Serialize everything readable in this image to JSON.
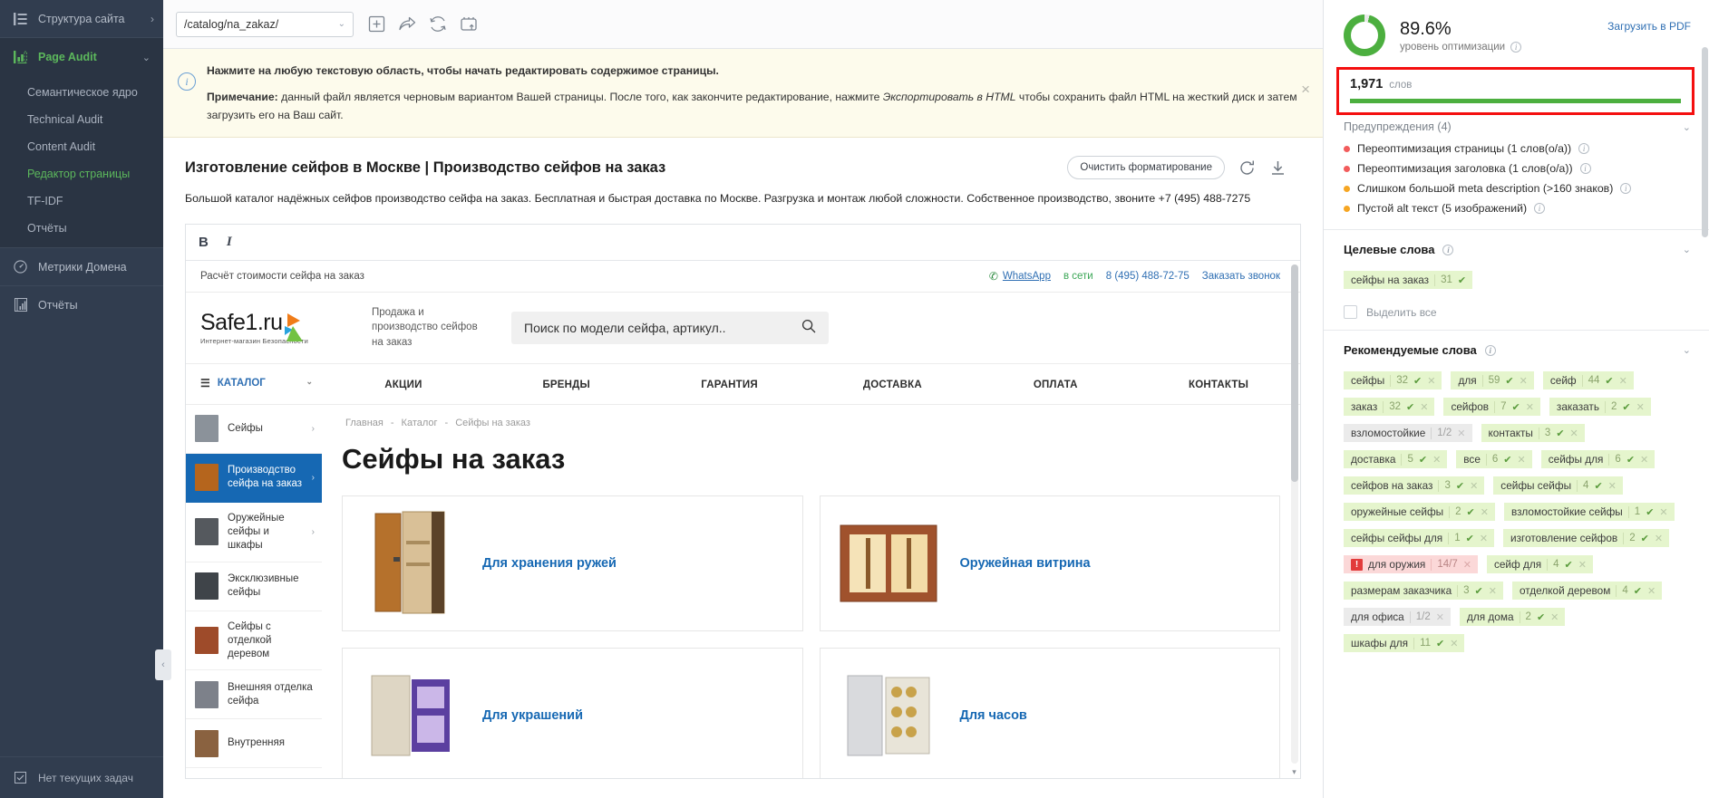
{
  "sidebar": {
    "structure": {
      "label": "Структура сайта",
      "icon": "list-icon",
      "chevron": "›"
    },
    "page_audit": {
      "label": "Page Audit",
      "icon": "bar-chart-icon",
      "chevron": "⌄"
    },
    "sub_items": [
      {
        "label": "Семантическое ядро",
        "selected": false
      },
      {
        "label": "Technical Audit",
        "selected": false
      },
      {
        "label": "Content Audit",
        "selected": false
      },
      {
        "label": "Редактор страницы",
        "selected": true
      },
      {
        "label": "TF-IDF",
        "selected": false
      },
      {
        "label": "Отчёты",
        "selected": false
      }
    ],
    "domain_metrics": {
      "label": "Метрики Домена",
      "icon": "gauge-icon"
    },
    "reports": {
      "label": "Отчёты",
      "icon": "report-icon"
    },
    "footer_status": "Нет текущих задач",
    "collapse_chevron": "‹"
  },
  "toolbar": {
    "url_value": "/catalog/na_zakaz/",
    "url_chevron": "⌄",
    "icons": [
      "add-page-icon",
      "share-icon",
      "refresh-icon",
      "export-html-icon"
    ],
    "menu_icon": "hamburger-icon"
  },
  "banner": {
    "icon": "info-icon",
    "line1": "Нажмите на любую текстовую область, чтобы начать редактировать содержимое страницы.",
    "note_label": "Примечание:",
    "note_part1": " данный файл является черновым вариантом Вашей страницы. После того, как закончите редактирование, нажмите ",
    "note_emphasis": "Экспортировать в HTML",
    "note_part2": " чтобы сохранить файл HTML на жесткий диск и затем загрузить его на Ваш сайт.",
    "close_icon": "close-icon"
  },
  "editor": {
    "page_title": "Изготовление сейфов в Москве | Производство сейфов на заказ",
    "clear_format_label": "Очистить форматирование",
    "refresh_icon": "refresh-icon",
    "download_icon": "download-icon",
    "page_description": "Большой каталог надёжных сейфов производство сейфа на заказ. Бесплатная и быстрая доставка по Москве. Разгрузка и монтаж любой сложности. Собственное производство, звоните +7 (495) 488-7275",
    "format_bold": "B",
    "format_italic": "I"
  },
  "preview": {
    "top_left": "Расчёт стоимости сейфа на заказ",
    "whatsapp_icon": "phone-icon",
    "whatsapp": "WhatsApp",
    "online": "в сети",
    "phone": "8 (495) 488-72-75",
    "callback": "Заказать звонок",
    "logo_main": "Safe1.ru",
    "logo_sub": "Интернет-магазин Безопасности",
    "slogan": "Продажа и производство сейфов на заказ",
    "search_placeholder": "Поиск по модели сейфа, артикул..",
    "search_icon": "search-icon",
    "catalog_label": "КАТАЛОГ",
    "catalog_burger": "☰",
    "nav": [
      "АКЦИИ",
      "БРЕНДЫ",
      "ГАРАНТИЯ",
      "ДОСТАВКА",
      "ОПЛАТА",
      "КОНТАКТЫ"
    ],
    "categories": [
      {
        "label": "Сейфы",
        "selected": false,
        "arrow": "›"
      },
      {
        "label": "Производство сейфа на заказ",
        "selected": true,
        "arrow": "›"
      },
      {
        "label": "Оружейные сейфы и шкафы",
        "selected": false,
        "arrow": "›"
      },
      {
        "label": "Эксклюзивные сейфы",
        "selected": false,
        "arrow": ""
      },
      {
        "label": "Сейфы с отделкой деревом",
        "selected": false,
        "arrow": ""
      },
      {
        "label": "Внешняя отделка сейфа",
        "selected": false,
        "arrow": ""
      },
      {
        "label": "Внутренняя",
        "selected": false,
        "arrow": ""
      }
    ],
    "breadcrumbs": [
      "Главная",
      "Каталог",
      "Сейфы на заказ"
    ],
    "h1": "Сейфы на заказ",
    "cards": [
      {
        "title": "Для хранения ружей"
      },
      {
        "title": "Оружейная витрина"
      },
      {
        "title": "Для украшений"
      },
      {
        "title": "Для часов"
      }
    ]
  },
  "panel": {
    "score_value": "89.6%",
    "score_label": "уровень оптимизации",
    "download_pdf": "Загрузить в PDF",
    "words_count": "1,971",
    "words_label": "слов",
    "warnings_title": "Предупреждения (4)",
    "warnings_chevron": "⌄",
    "warnings": [
      {
        "text": "Переоптимизация страницы (1 слов(о/а))",
        "color": "red"
      },
      {
        "text": "Переоптимизация заголовка (1 слов(о/а))",
        "color": "red"
      },
      {
        "text": "Слишком большой meta description (>160 знаков)",
        "color": "orange"
      },
      {
        "text": "Пустой alt текст (5 изображений)",
        "color": "orange"
      }
    ],
    "target_words": {
      "title": "Целевые слова",
      "chevron": "⌄",
      "chips": [
        {
          "word": "сейфы на заказ",
          "count": "31",
          "state": "green",
          "ok": true,
          "close": false
        }
      ],
      "select_all_label": "Выделить все"
    },
    "recommended_words": {
      "title": "Рекомендуемые слова",
      "chevron": "⌄",
      "chips": [
        {
          "word": "сейфы",
          "count": "32",
          "state": "green",
          "ok": true,
          "close": true
        },
        {
          "word": "для",
          "count": "59",
          "state": "green",
          "ok": true,
          "close": true
        },
        {
          "word": "сейф",
          "count": "44",
          "state": "green",
          "ok": true,
          "close": true
        },
        {
          "word": "заказ",
          "count": "32",
          "state": "green",
          "ok": true,
          "close": true
        },
        {
          "word": "сейфов",
          "count": "7",
          "state": "green",
          "ok": true,
          "close": true
        },
        {
          "word": "заказать",
          "count": "2",
          "state": "green",
          "ok": true,
          "close": true
        },
        {
          "word": "взломостойкие",
          "count": "1/2",
          "state": "grey",
          "ok": false,
          "close": true
        },
        {
          "word": "контакты",
          "count": "3",
          "state": "green",
          "ok": true,
          "close": true
        },
        {
          "word": "доставка",
          "count": "5",
          "state": "green",
          "ok": true,
          "close": true
        },
        {
          "word": "все",
          "count": "6",
          "state": "green",
          "ok": true,
          "close": true
        },
        {
          "word": "сейфы для",
          "count": "6",
          "state": "green",
          "ok": true,
          "close": true
        },
        {
          "word": "сейфов на заказ",
          "count": "3",
          "state": "green",
          "ok": true,
          "close": true
        },
        {
          "word": "сейфы сейфы",
          "count": "4",
          "state": "green",
          "ok": true,
          "close": true
        },
        {
          "word": "оружейные сейфы",
          "count": "2",
          "state": "green",
          "ok": true,
          "close": true
        },
        {
          "word": "взломостойкие сейфы",
          "count": "1",
          "state": "green",
          "ok": true,
          "close": true
        },
        {
          "word": "сейфы сейфы для",
          "count": "1",
          "state": "green",
          "ok": true,
          "close": true
        },
        {
          "word": "изготовление сейфов",
          "count": "2",
          "state": "green",
          "ok": true,
          "close": true
        },
        {
          "word": "для оружия",
          "count": "14/7",
          "state": "pink",
          "ok": false,
          "close": true,
          "alert": true
        },
        {
          "word": "сейф для",
          "count": "4",
          "state": "green",
          "ok": true,
          "close": true
        },
        {
          "word": "размерам заказчика",
          "count": "3",
          "state": "green",
          "ok": true,
          "close": true
        },
        {
          "word": "отделкой деревом",
          "count": "4",
          "state": "green",
          "ok": true,
          "close": true
        },
        {
          "word": "для офиса",
          "count": "1/2",
          "state": "grey",
          "ok": false,
          "close": true
        },
        {
          "word": "для дома",
          "count": "2",
          "state": "green",
          "ok": true,
          "close": true
        },
        {
          "word": "шкафы для",
          "count": "11",
          "state": "green",
          "ok": true,
          "close": true
        }
      ]
    }
  },
  "colors": {
    "sidebar_bg": "#313d4f",
    "accent_green": "#4caf3f",
    "link_blue": "#2f6fb3",
    "alert_red": "#f40f0f",
    "warn_orange": "#f6a623",
    "site_blue": "#1668b3"
  }
}
